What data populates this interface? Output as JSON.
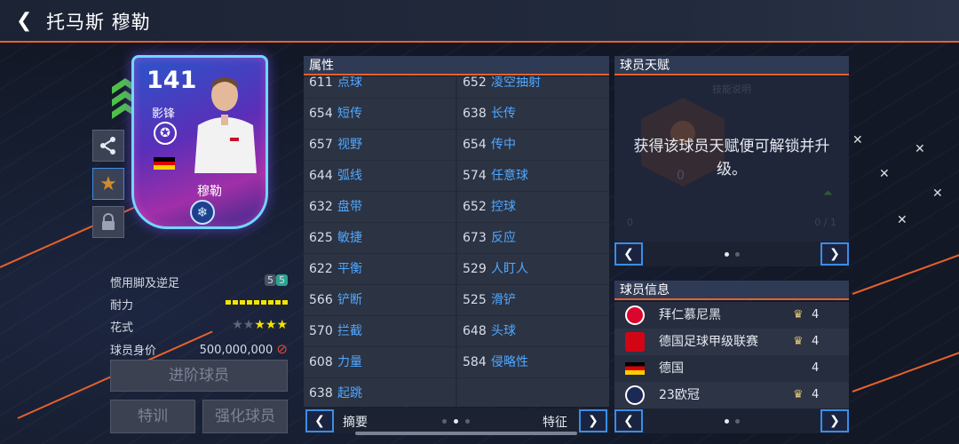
{
  "header": {
    "title": "托马斯 穆勒"
  },
  "card": {
    "rating": "141",
    "position": "影锋",
    "name": "穆勒",
    "colors": {
      "frame": "#6fd8ff",
      "nation_flag": [
        "#000000",
        "#dd0000",
        "#ffce00"
      ]
    }
  },
  "side_actions": [
    "share-icon",
    "star-icon",
    "lock-icon"
  ],
  "player_stats": {
    "weak_foot_label": "惯用脚及逆足",
    "weak_foot_values": [
      "5",
      "5"
    ],
    "stamina_label": "耐力",
    "skills_label": "花式",
    "skills_stars_filled": 3,
    "skills_stars_total": 5,
    "value_label": "球员身价",
    "value": "500,000,000"
  },
  "buttons": {
    "advance": "进阶球员",
    "train": "特训",
    "enhance": "强化球员"
  },
  "attributes": {
    "header": "属性",
    "items": [
      {
        "value": "611",
        "name": "点球"
      },
      {
        "value": "652",
        "name": "凌空抽射"
      },
      {
        "value": "654",
        "name": "短传"
      },
      {
        "value": "638",
        "name": "长传"
      },
      {
        "value": "657",
        "name": "视野"
      },
      {
        "value": "654",
        "name": "传中"
      },
      {
        "value": "644",
        "name": "弧线"
      },
      {
        "value": "574",
        "name": "任意球"
      },
      {
        "value": "632",
        "name": "盘带"
      },
      {
        "value": "652",
        "name": "控球"
      },
      {
        "value": "625",
        "name": "敏捷"
      },
      {
        "value": "673",
        "name": "反应"
      },
      {
        "value": "622",
        "name": "平衡"
      },
      {
        "value": "529",
        "name": "人盯人"
      },
      {
        "value": "566",
        "name": "铲断"
      },
      {
        "value": "525",
        "name": "滑铲"
      },
      {
        "value": "570",
        "name": "拦截"
      },
      {
        "value": "648",
        "name": "头球"
      },
      {
        "value": "608",
        "name": "力量"
      },
      {
        "value": "584",
        "name": "侵略性"
      },
      {
        "value": "638",
        "name": "起跳"
      }
    ],
    "footer_left": "摘要",
    "footer_right": "特征"
  },
  "talent": {
    "header": "球员天赋",
    "message": "获得该球员天赋便可解锁并升级。",
    "faded_label": "技能说明",
    "faded_value": "0",
    "faded_left": "0",
    "faded_right": "0 / 1"
  },
  "info": {
    "header": "球员信息",
    "rows": [
      {
        "name": "拜仁慕尼黑",
        "level": "4",
        "icon": "club-badge-icon",
        "crown": true
      },
      {
        "name": "德国足球甲级联赛",
        "level": "4",
        "icon": "league-badge-icon",
        "crown": true
      },
      {
        "name": "德国",
        "level": "4",
        "icon": "flag-icon",
        "crown": false
      },
      {
        "name": "23欧冠",
        "level": "4",
        "icon": "ucl-icon",
        "crown": true
      }
    ]
  },
  "colors": {
    "accent": "#e8612c",
    "link_blue": "#4fa8ff",
    "nav_border": "#3b8de8"
  }
}
